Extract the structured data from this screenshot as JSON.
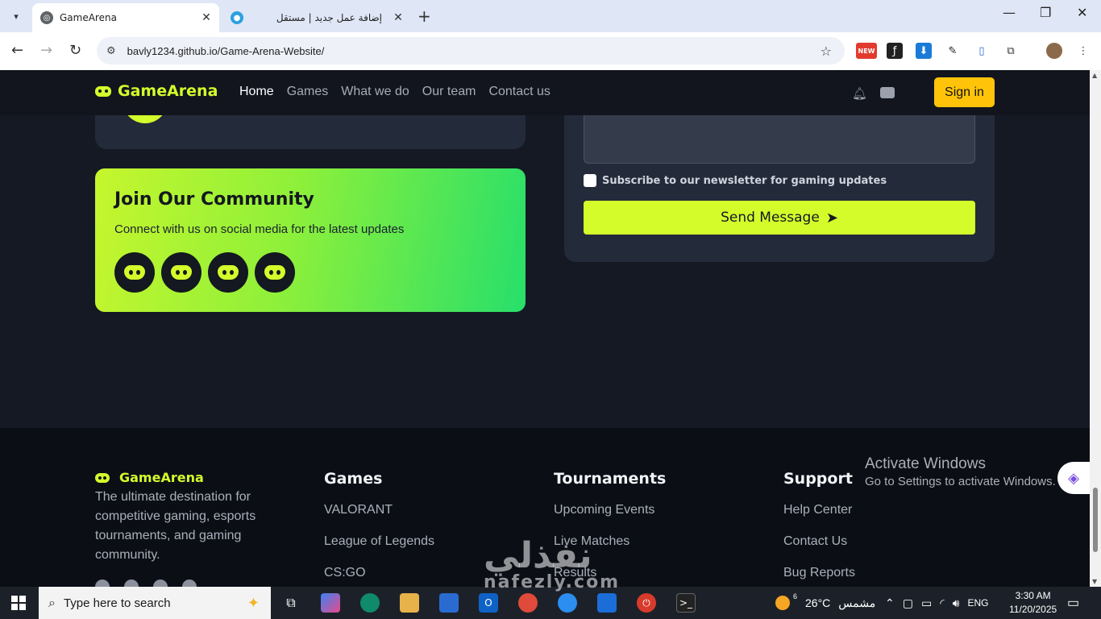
{
  "browser": {
    "tabs": [
      {
        "title": "GameArena",
        "active": true
      },
      {
        "title": "إضافة عمل جديد | مستقل",
        "active": false
      }
    ],
    "url": "bavly1234.github.io/Game-Arena-Website/",
    "new_badge": "NEW"
  },
  "site": {
    "brand": "GameArena",
    "nav": [
      "Home",
      "Games",
      "What we do",
      "Our team",
      "Contact us"
    ],
    "active_nav": "Home",
    "signin": "Sign in",
    "community": {
      "title": "Join Our Community",
      "subtitle": "Connect with us on social media for the latest updates"
    },
    "form": {
      "newsletter_label": "Subscribe to our newsletter for gaming updates",
      "send_label": "Send Message"
    },
    "footer": {
      "brand": "GameArena",
      "description": "The ultimate destination for competitive gaming, esports tournaments, and gaming community.",
      "columns": [
        {
          "title": "Games",
          "links": [
            "VALORANT",
            "League of Legends",
            "CS:GO"
          ]
        },
        {
          "title": "Tournaments",
          "links": [
            "Upcoming Events",
            "Live Matches",
            "Results"
          ]
        },
        {
          "title": "Support",
          "links": [
            "Help Center",
            "Contact Us",
            "Bug Reports"
          ]
        }
      ]
    }
  },
  "overlay": {
    "activate_title": "Activate Windows",
    "activate_sub": "Go to Settings to activate Windows.",
    "watermark_ar": "نفذلي",
    "watermark_en": "nafezly.com"
  },
  "taskbar": {
    "search_placeholder": "Type here to search",
    "weather_temp": "26°C",
    "weather_label": "مشمس",
    "weather_badge": "6",
    "lang": "ENG",
    "time": "3:30 AM",
    "date": "11/20/2025"
  },
  "colors": {
    "accent": "#d4fc2b",
    "signin": "#ffc40a",
    "page_bg": "#151923"
  }
}
